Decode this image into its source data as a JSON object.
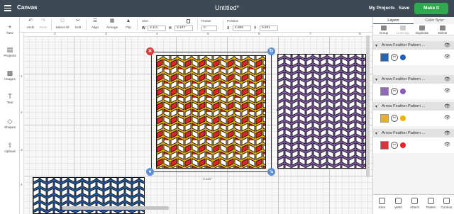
{
  "header": {
    "app_title": "Canvas",
    "doc_title": "Untitled*",
    "my_projects": "My Projects",
    "save": "Save",
    "make_it": "Make It"
  },
  "toolbar": {
    "undo": "Undo",
    "redo": "Redo",
    "select_all": "Select All",
    "edit": "Edit",
    "align": "Align",
    "arrange": "Arrange",
    "flip": "Flip",
    "size_label": "Size",
    "w_letter": "W",
    "w_value": "3.111",
    "h_letter": "H",
    "h_value": "3.107",
    "rotate_label": "Rotate",
    "rotate_value": "0",
    "position_label": "Position",
    "x_letter": "X",
    "x_value": "4.806",
    "y_letter": "Y",
    "y_value": "0.401"
  },
  "sidebar": {
    "items": [
      {
        "label": "New",
        "icon": "plus-icon"
      },
      {
        "label": "Projects",
        "icon": "projects-icon"
      },
      {
        "label": "Images",
        "icon": "images-icon"
      },
      {
        "label": "Text",
        "icon": "text-icon"
      },
      {
        "label": "Shapes",
        "icon": "shapes-icon"
      },
      {
        "label": "Upload",
        "icon": "upload-icon"
      }
    ]
  },
  "canvas": {
    "ruler_top": [
      "2",
      "3",
      "4",
      "5",
      "6",
      "7",
      "8"
    ],
    "ruler_left": [
      "1",
      "2",
      "3",
      "4"
    ],
    "width_label": "3.111\"",
    "height_label": "3.107\""
  },
  "panel": {
    "tab_layers": "Layers",
    "tab_color_sync": "Color Sync",
    "tools": {
      "group": "Group",
      "ungroup": "UnGroup",
      "duplicate": "Duplicate",
      "delete": "Delete"
    },
    "layers": [
      {
        "name": "Arrow Feather Pattern ...",
        "color": "#1e5fb4",
        "swatch": "#2a63b0"
      },
      {
        "name": "Arrow Feather Pattern ...",
        "color": "#8a5bb5",
        "swatch": "#9069b8"
      },
      {
        "name": "Arrow Feather Pattern ...",
        "color": "#f1b30a",
        "swatch": "#e5b030"
      },
      {
        "name": "Arrow Feather Pattern ...",
        "color": "#e4232b",
        "swatch": "#d8343b"
      }
    ],
    "bottom_tools": {
      "slice": "Slice",
      "weld": "Weld",
      "attach": "Attach",
      "flatten": "Flatten",
      "contour": "Contour"
    }
  },
  "colors": {
    "topbar": "#3d4a56",
    "make_it": "#2fa84f",
    "yellow": "#f1b30a",
    "red": "#e4232b",
    "purple": "#8a5bb5",
    "blue": "#1e5fb4"
  }
}
